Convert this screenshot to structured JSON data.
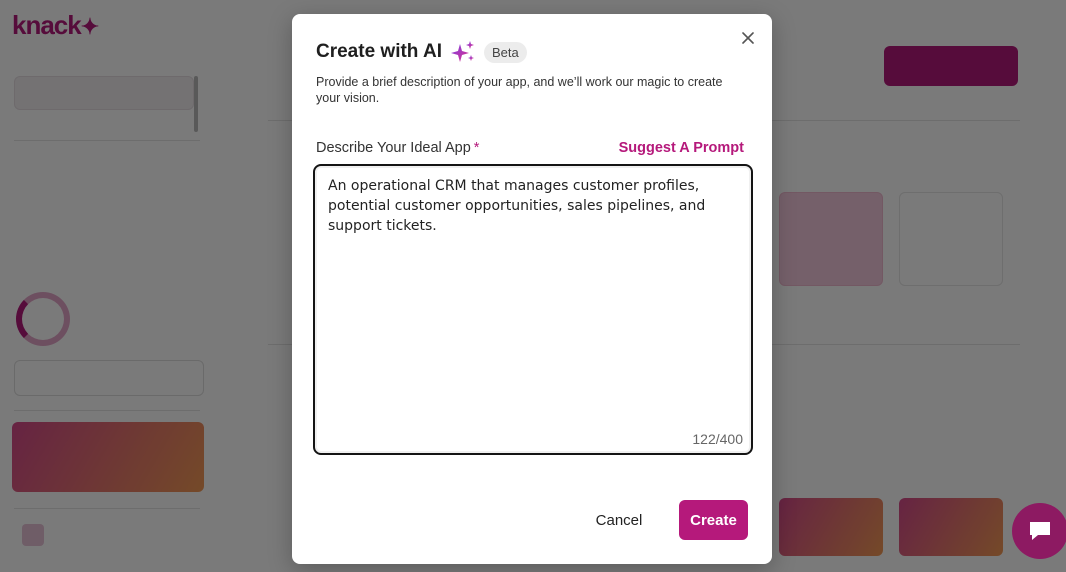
{
  "modal": {
    "title": "Create with AI",
    "badge": "Beta",
    "description": "Provide a brief description of your app, and we’ll work our magic to create your vision.",
    "field_label": "Describe Your Ideal App",
    "required_marker": "*",
    "suggest_label": "Suggest A Prompt",
    "textarea_value": "An operational CRM that manages customer profiles, potential customer opportunities, sales pipelines, and support tickets.",
    "char_count": "122/400",
    "cancel_label": "Cancel",
    "create_label": "Create",
    "close_icon": "close-icon",
    "title_icon": "sparkle-icon"
  },
  "colors": {
    "accent": "#b5197b",
    "overlay": "rgba(0,0,0,0.52)",
    "chat_bubble": "#8d1a62"
  },
  "chat": {
    "icon": "chat-icon"
  }
}
